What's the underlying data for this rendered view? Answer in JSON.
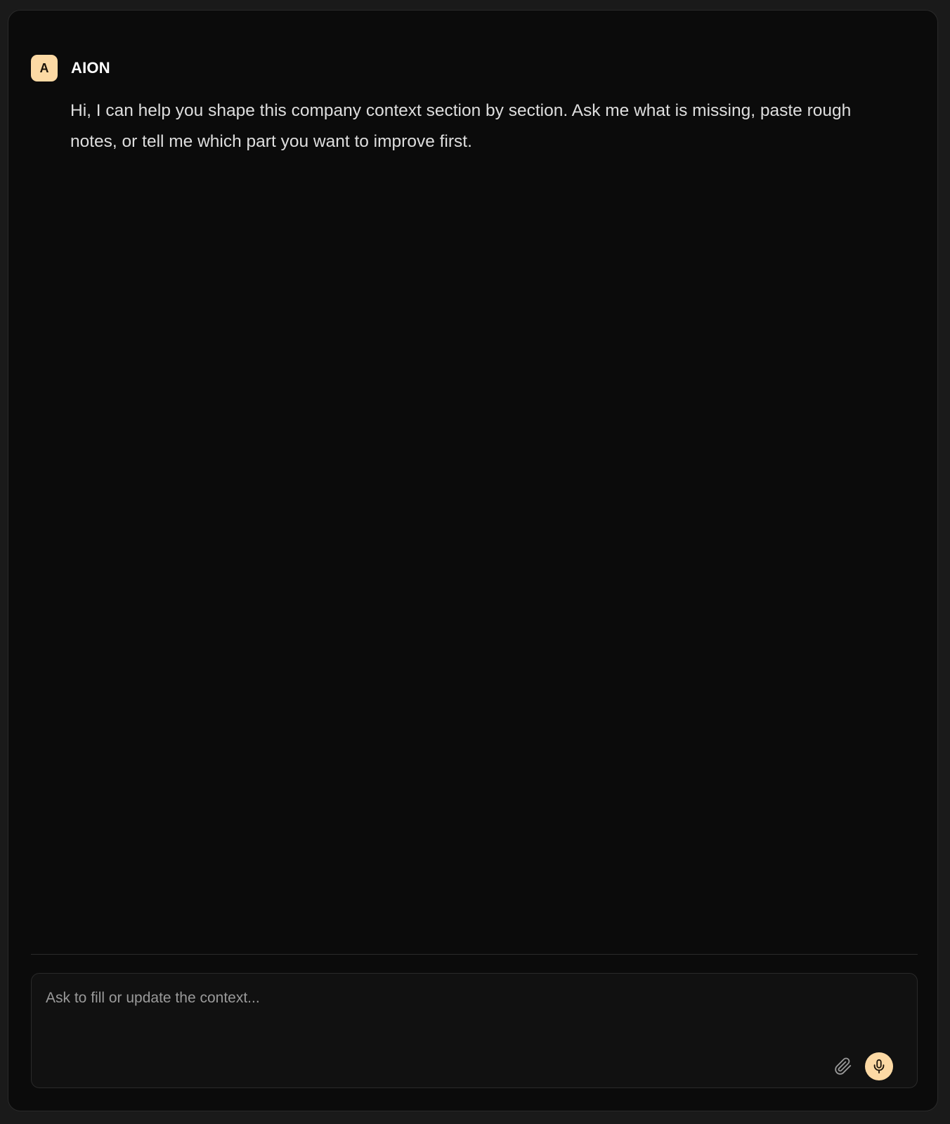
{
  "message": {
    "avatar_letter": "A",
    "sender": "AION",
    "text": "Hi, I can help you shape this company context section by section. Ask me what is missing, paste rough notes, or tell me which part you want to improve first."
  },
  "composer": {
    "value": "",
    "placeholder": "Ask to fill or update the context...",
    "attach_icon": "paperclip-icon",
    "mic_icon": "microphone-icon"
  },
  "colors": {
    "accent": "#fcd9a4",
    "panel_bg": "#0b0b0b",
    "page_bg": "#1a1a1a"
  }
}
